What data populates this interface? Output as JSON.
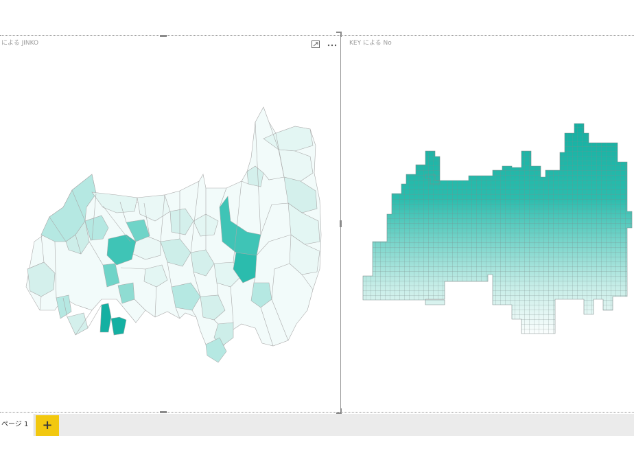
{
  "report": {
    "left_visual": {
      "title": "による JINKO"
    },
    "right_visual": {
      "title": "KEY による No"
    }
  },
  "colors": {
    "fill_dark": "#14b0a2",
    "fill_mid": "#3fc4b6",
    "fill_light": "#b5e8e2",
    "fill_pale": "#f2fbfa",
    "border": "#9a9a9a",
    "tab_add": "#f2c80f"
  },
  "icons": {
    "focus_mode": "focus-mode-icon",
    "more_options": "more-options-icon",
    "add_page": "plus-icon"
  },
  "tabs": {
    "pages": [
      {
        "label": "ページ 1",
        "active": true
      }
    ],
    "add_label": "+"
  }
}
